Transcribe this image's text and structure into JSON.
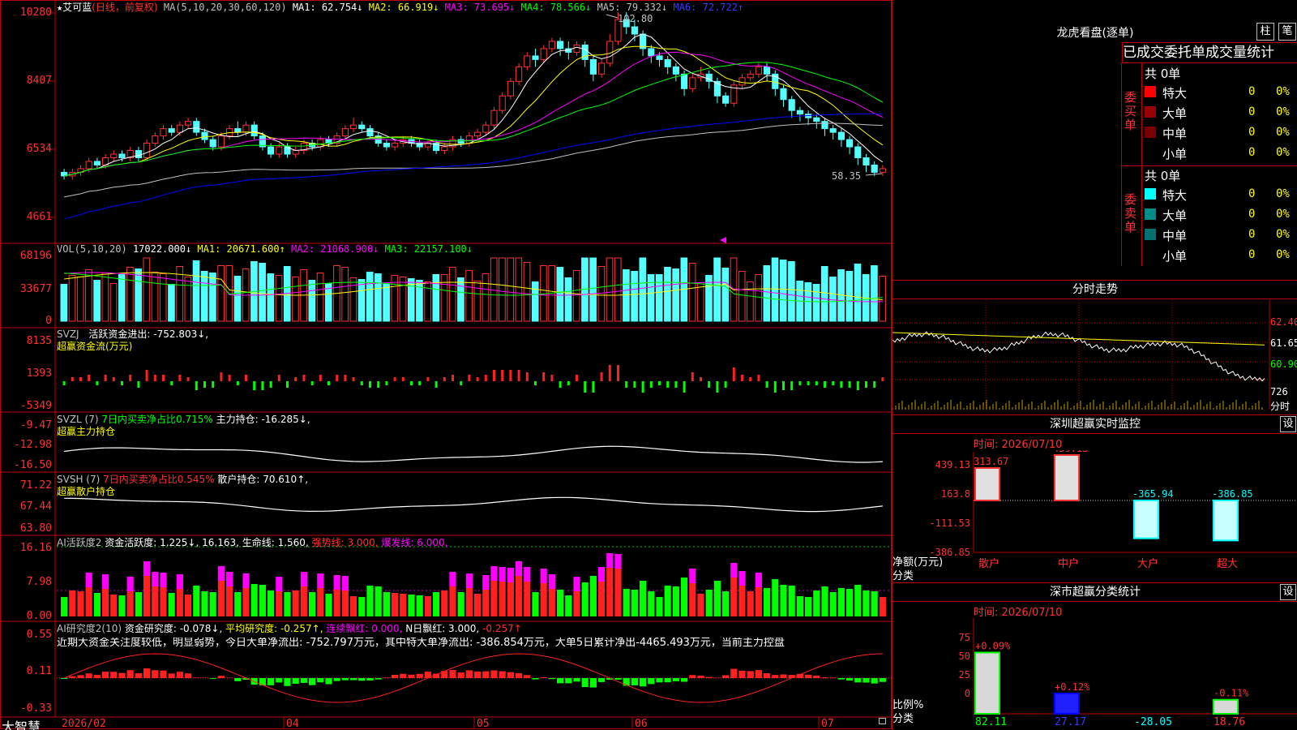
{
  "stock": {
    "name": "艾可蓝",
    "period": "(日线，前复权)",
    "ma_label": "MA(5,10,20,30,60,120)",
    "ma1": "MA1: 62.754↓",
    "ma2": "MA2: 66.919↓",
    "ma3": "MA3: 73.695↓",
    "ma4": "MA4: 78.566↓",
    "ma5": "MA5: 79.332↓",
    "ma6": "MA6: 72.722↑",
    "high_mark": "102.80",
    "low_mark": "58.35"
  },
  "price_axis": [
    "10280",
    "8407",
    "6534",
    "4661"
  ],
  "volume": {
    "label": "VOL(5,10,20)",
    "value": "17022.000↓",
    "ma1": "MA1: 20671.600↑",
    "ma2": "MA2: 21068.900↓",
    "ma3": "MA3: 22157.100↓",
    "axis": [
      "68196",
      "33677",
      "0"
    ]
  },
  "svzj": {
    "label": "SVZJ",
    "desc": "活跃资金进出: -752.803↓,",
    "sub": "超赢资金流(万元)",
    "axis": [
      "8135",
      "1393",
      "-5349"
    ]
  },
  "svzl": {
    "label": "SVZL (7)",
    "desc1": "7日内买卖净占比0.715%",
    "desc2": "主力持仓: -16.285↓,",
    "sub": "超赢主力持仓",
    "axis": [
      "-9.47",
      "-12.98",
      "-16.50"
    ]
  },
  "svsh": {
    "label": "SVSH (7)",
    "desc1": "7日内买卖净占比0.545%",
    "desc2": "散户持仓: 70.610↑,",
    "sub": "超赢散户持仓",
    "axis": [
      "71.22",
      "67.44",
      "63.80"
    ]
  },
  "ai1": {
    "label": "AI活跃度2",
    "desc": "资金活跃度: 1.225↓, 16.163, 生命线: 1.560,",
    "strong": "强势线: 3.000,",
    "burst": "爆发线: 6.000,",
    "axis": [
      "16.16",
      "7.98",
      "0.00"
    ]
  },
  "ai2": {
    "label": "AI研究度2(10)",
    "desc": "资金研究度: -0.078↓,",
    "avg": "平均研究度: -0.257↑,",
    "cont": "连续飘红: 0.000,",
    "nday": "N日飘红: 3.000,",
    "last": "-0.257↑",
    "comment": "近期大资金关注度较低，明显弱势，今日大单净流出: -752.797万元，其中特大单净流出: -386.854万元，大单5日累计净出-4465.493万元，当前主力控盘",
    "axis": [
      "0.55",
      "0.11",
      "-0.33"
    ]
  },
  "date_axis": [
    "2026/02",
    "04",
    "05",
    "06",
    "07"
  ],
  "brand": "大智慧",
  "dragon": {
    "title": "龙虎看盘(逐单)",
    "btn1": "柱",
    "btn2": "笔",
    "tabs": "已成交委托单成交量统计",
    "buy_label": "委买单",
    "sell_label": "委卖单",
    "buy_total": "共 0单",
    "sell_total": "共 0单",
    "rows": [
      {
        "name": "特大",
        "count": "0",
        "pct": "0%"
      },
      {
        "name": "大单",
        "count": "0",
        "pct": "0%"
      },
      {
        "name": "中单",
        "count": "0",
        "pct": "0%"
      },
      {
        "name": "小单",
        "count": "0",
        "pct": "0%"
      }
    ],
    "buy_colors": [
      "#ff0000",
      "#990000",
      "#7a0000",
      "#000000"
    ],
    "sell_colors": [
      "#00ffff",
      "#008b8b",
      "#007070",
      "#000000"
    ]
  },
  "intraday": {
    "title": "分时走势",
    "axis": [
      "62.40",
      "61.65",
      "60.90"
    ],
    "vol": "726",
    "vol_label": "分时"
  },
  "monitor": {
    "title": "深圳超赢实时监控",
    "btn": "设",
    "time": "时间: 2026/07/10",
    "axis": [
      "439.13",
      "163.8",
      "-111.53",
      "-386.85"
    ],
    "ylabel": "净额(万元)",
    "xlabel": "分类",
    "cats": [
      "散户",
      "中户",
      "大户",
      "超大"
    ],
    "values": [
      "313.67",
      "439.13",
      "-365.94",
      "-386.85"
    ]
  },
  "classify": {
    "title": "深市超赢分类统计",
    "btn": "设",
    "time": "时间: 2026/07/10",
    "axis": [
      "75",
      "50",
      "25",
      "0"
    ],
    "ylabel": "比例%",
    "xlabel": "分类",
    "cats": [
      "散户",
      "中户",
      "大户",
      "超大"
    ],
    "values": [
      "82.11",
      "27.17",
      "-28.05",
      "18.76"
    ],
    "pcts": [
      "+0.09%",
      "+0.12%",
      "",
      "-0.11%"
    ]
  },
  "chart_data": {
    "type": "candlestick",
    "price_range": [
      46.61,
      102.8
    ],
    "ma_colors": [
      "#ffffff",
      "#ffff00",
      "#ff00ff",
      "#00ff00",
      "#c0c0c0",
      "#0000ff"
    ],
    "candles": [
      [
        59,
        58,
        60,
        57
      ],
      [
        58,
        59,
        60,
        57
      ],
      [
        59,
        60,
        61,
        58
      ],
      [
        60,
        62,
        63,
        59
      ],
      [
        62,
        61,
        63,
        60
      ],
      [
        61,
        63,
        64,
        60
      ],
      [
        63,
        64,
        65,
        62
      ],
      [
        64,
        63,
        65,
        62
      ],
      [
        63,
        65,
        66,
        62
      ],
      [
        65,
        63,
        66,
        62
      ],
      [
        63,
        67,
        68,
        62
      ],
      [
        67,
        69,
        70,
        66
      ],
      [
        69,
        71,
        72,
        68
      ],
      [
        71,
        70,
        72,
        69
      ],
      [
        70,
        72,
        73,
        69
      ],
      [
        72,
        73,
        74,
        71
      ],
      [
        73,
        70,
        74,
        69
      ],
      [
        70,
        68,
        71,
        67
      ],
      [
        68,
        66,
        69,
        65
      ],
      [
        66,
        69,
        70,
        65
      ],
      [
        69,
        71,
        72,
        68
      ],
      [
        71,
        70,
        73,
        69
      ],
      [
        70,
        72,
        73,
        69
      ],
      [
        72,
        69,
        73,
        68
      ],
      [
        69,
        66,
        70,
        65
      ],
      [
        66,
        64,
        67,
        63
      ],
      [
        64,
        66,
        67,
        63
      ],
      [
        66,
        64,
        67,
        63
      ],
      [
        64,
        65,
        66,
        63
      ],
      [
        65,
        67,
        68,
        64
      ],
      [
        67,
        66,
        68,
        65
      ],
      [
        66,
        68,
        69,
        65
      ],
      [
        68,
        67,
        69,
        66
      ],
      [
        67,
        69,
        70,
        66
      ],
      [
        69,
        71,
        72,
        68
      ],
      [
        71,
        72,
        74,
        70
      ],
      [
        72,
        71,
        73,
        70
      ],
      [
        71,
        69,
        72,
        68
      ],
      [
        69,
        67,
        70,
        66
      ],
      [
        67,
        66,
        68,
        65
      ],
      [
        66,
        67,
        68,
        65
      ],
      [
        67,
        68,
        69,
        66
      ],
      [
        68,
        67,
        69,
        66
      ],
      [
        67,
        66,
        68,
        65
      ],
      [
        66,
        67,
        68,
        65
      ],
      [
        67,
        65,
        68,
        64
      ],
      [
        65,
        66,
        67,
        64
      ],
      [
        66,
        68,
        69,
        65
      ],
      [
        68,
        67,
        69,
        66
      ],
      [
        67,
        69,
        70,
        66
      ],
      [
        69,
        70,
        71,
        68
      ],
      [
        70,
        72,
        73,
        69
      ],
      [
        72,
        76,
        77,
        71
      ],
      [
        76,
        80,
        81,
        75
      ],
      [
        80,
        84,
        85,
        79
      ],
      [
        84,
        88,
        89,
        83
      ],
      [
        88,
        91,
        92,
        87
      ],
      [
        91,
        90,
        93,
        88
      ],
      [
        90,
        93,
        94,
        89
      ],
      [
        93,
        95,
        96,
        92
      ],
      [
        95,
        93,
        96,
        91
      ],
      [
        93,
        92,
        95,
        90
      ],
      [
        92,
        94,
        95,
        91
      ],
      [
        94,
        90,
        95,
        88
      ],
      [
        90,
        86,
        91,
        84
      ],
      [
        86,
        89,
        90,
        85
      ],
      [
        89,
        95,
        97,
        88
      ],
      [
        95,
        101,
        103,
        94
      ],
      [
        101,
        99,
        103,
        97
      ],
      [
        99,
        97,
        101,
        95
      ],
      [
        97,
        93,
        98,
        91
      ],
      [
        93,
        91,
        94,
        89
      ],
      [
        91,
        90,
        92,
        88
      ],
      [
        90,
        88,
        91,
        86
      ],
      [
        88,
        86,
        89,
        84
      ],
      [
        86,
        82,
        87,
        80
      ],
      [
        82,
        85,
        86,
        81
      ],
      [
        85,
        86,
        88,
        84
      ],
      [
        86,
        84,
        87,
        82
      ],
      [
        84,
        80,
        85,
        78
      ],
      [
        80,
        78,
        81,
        77
      ],
      [
        78,
        83,
        84,
        77
      ],
      [
        83,
        85,
        86,
        82
      ],
      [
        85,
        86,
        87,
        84
      ],
      [
        86,
        88,
        89,
        85
      ],
      [
        88,
        86,
        89,
        84
      ],
      [
        86,
        82,
        87,
        80
      ],
      [
        82,
        79,
        83,
        77
      ],
      [
        79,
        76,
        80,
        74
      ],
      [
        76,
        75,
        77,
        73
      ],
      [
        75,
        74,
        76,
        72
      ],
      [
        74,
        73,
        75,
        71
      ],
      [
        73,
        71,
        74,
        69
      ],
      [
        71,
        70,
        72,
        68
      ],
      [
        70,
        68,
        71,
        66
      ],
      [
        68,
        66,
        69,
        64
      ],
      [
        66,
        63,
        67,
        61
      ],
      [
        63,
        61,
        64,
        59
      ],
      [
        61,
        59,
        62,
        58
      ],
      [
        59,
        60,
        61,
        58
      ]
    ]
  }
}
